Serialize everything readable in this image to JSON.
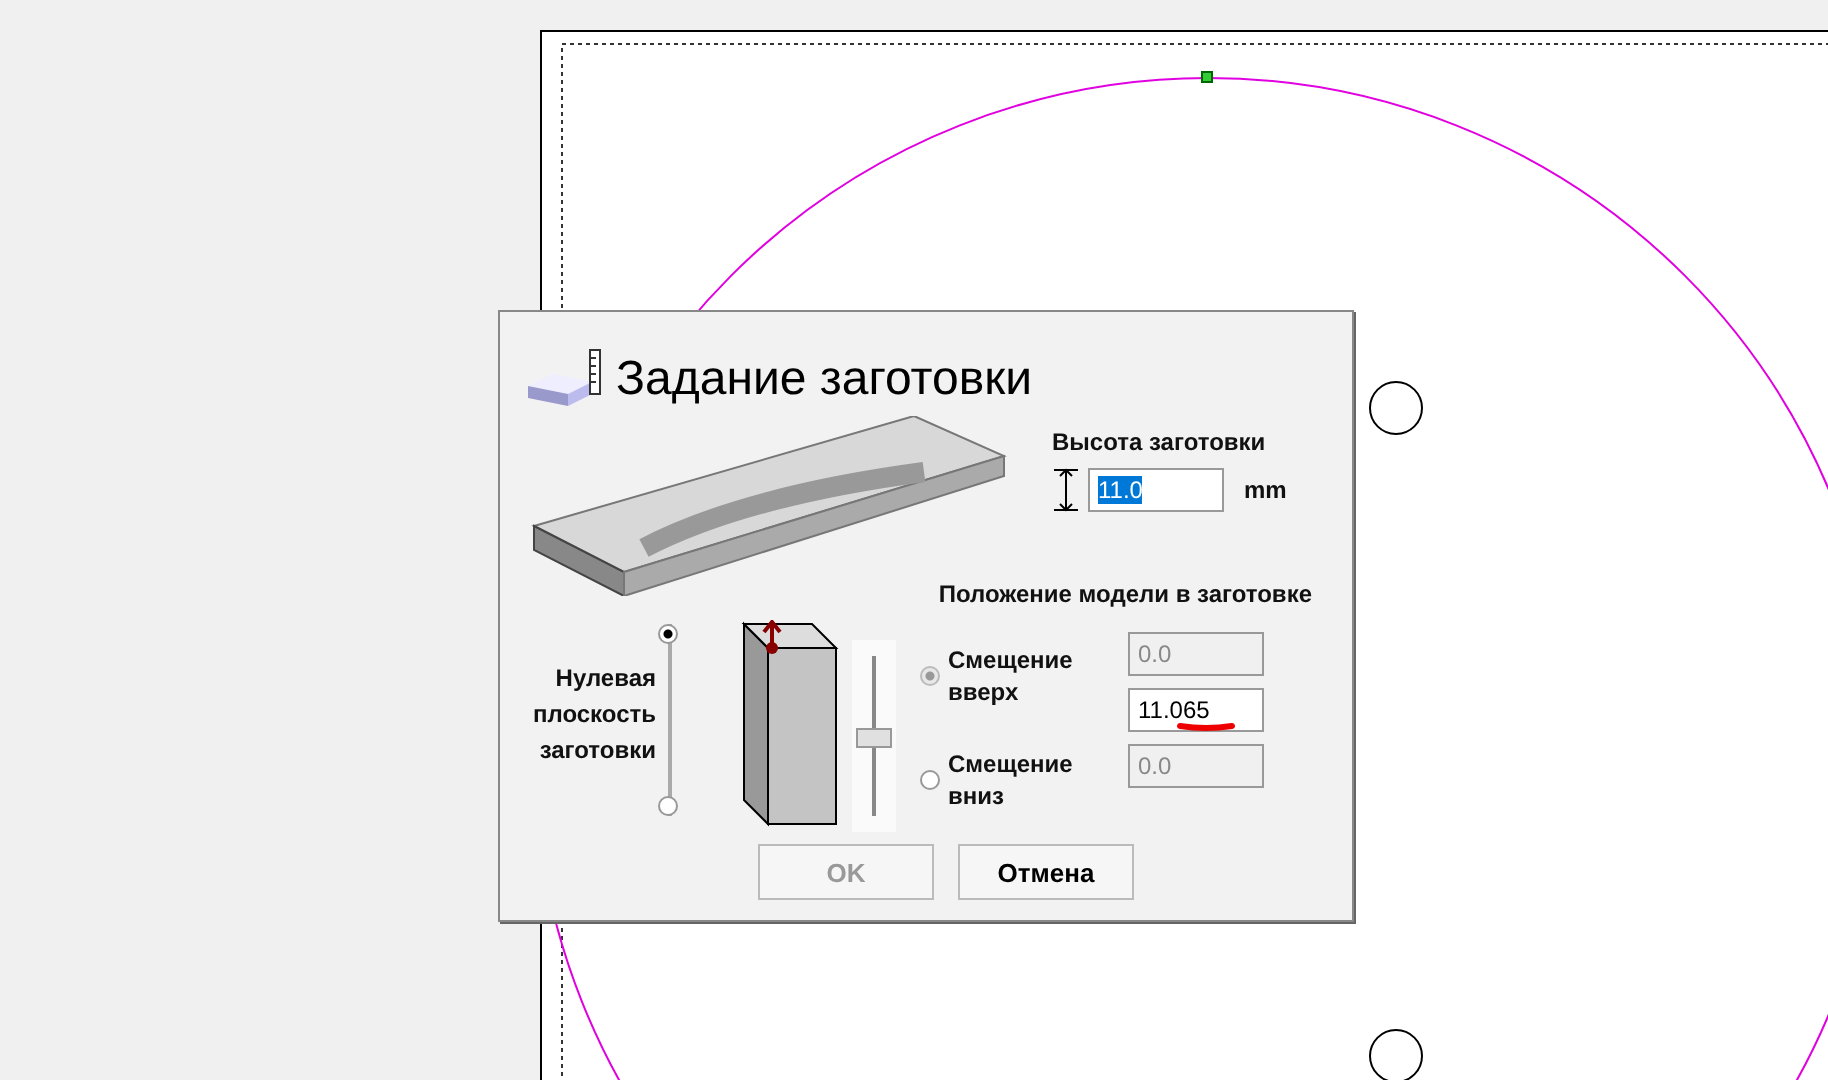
{
  "dialog": {
    "title": "Задание заготовки",
    "height_label": "Высота заготовки",
    "height_value": "11.0",
    "unit": "mm",
    "position_label": "Положение модели в заготовке",
    "zero_plane_label": "Нулевая плоскость заготовки",
    "zero_plane_options": [
      {
        "selected": true
      },
      {
        "selected": false
      }
    ],
    "slider": {
      "level": 0.5
    },
    "offset_options": [
      {
        "label": "Смещение вверх",
        "selected": true,
        "disabled": true
      },
      {
        "label": "Смещение вниз",
        "selected": false,
        "disabled": false
      }
    ],
    "offset_fields": [
      {
        "value": "0.0",
        "disabled": true
      },
      {
        "value": "11.065",
        "disabled": false,
        "underlined": true
      },
      {
        "value": "0.0",
        "disabled": true
      }
    ],
    "buttons": [
      {
        "label": "OK",
        "disabled": true
      },
      {
        "label": "Отмена",
        "disabled": false
      }
    ]
  }
}
